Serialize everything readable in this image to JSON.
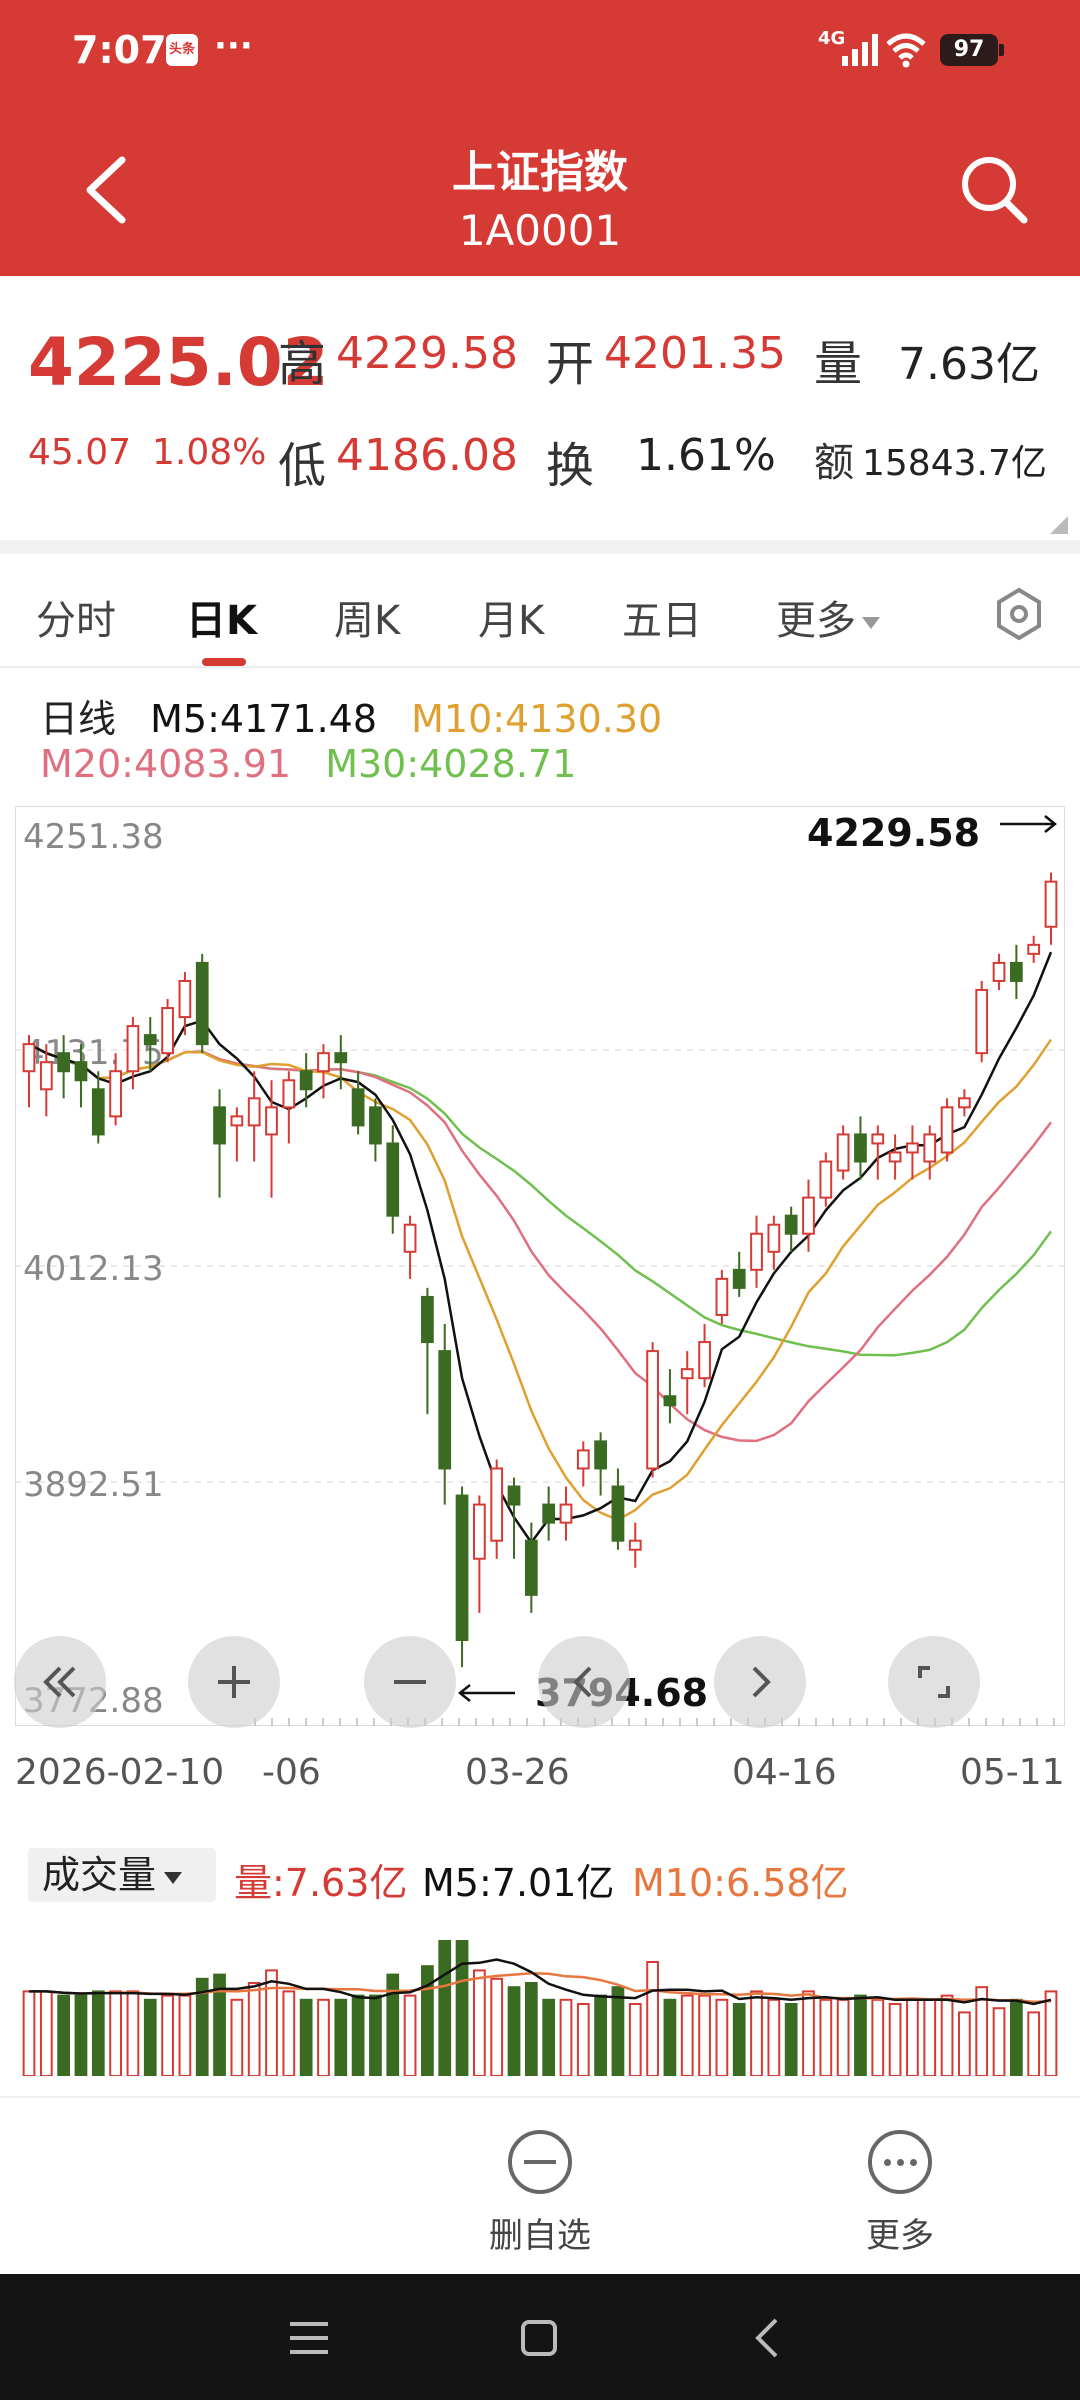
{
  "status_bar": {
    "time": "7:07",
    "notification_badge": "头条",
    "dots": "···",
    "network": "4G",
    "battery": "97"
  },
  "header": {
    "title": "上证指数",
    "code": "1A0001"
  },
  "quote": {
    "price": "4225.02",
    "change": "45.07",
    "change_pct": "1.08%",
    "high_label": "高",
    "high": "4229.58",
    "low_label": "低",
    "low": "4186.08",
    "open_label": "开",
    "open": "4201.35",
    "turnover_label": "换",
    "turnover": "1.61%",
    "volume_label": "量",
    "volume": "7.63亿",
    "amount_label": "额",
    "amount": "15843.7亿"
  },
  "tabs": [
    {
      "label": "分时",
      "active": false
    },
    {
      "label": "日K",
      "active": true
    },
    {
      "label": "周K",
      "active": false
    },
    {
      "label": "月K",
      "active": false
    },
    {
      "label": "五日",
      "active": false
    },
    {
      "label": "更多",
      "active": false
    }
  ],
  "colors": {
    "up": "#d63a35",
    "down": "#3b6b22",
    "ma5": "#111111",
    "ma10": "#e0a030",
    "ma20": "#e07080",
    "ma30": "#70c050",
    "vol_ma10": "#e8763f"
  },
  "legend": {
    "period": "日线",
    "ma5": "M5:4171.48",
    "ma10": "M10:4130.30",
    "ma20": "M20:4083.91",
    "ma30": "M30:4028.71"
  },
  "chart_data": {
    "type": "candlestick",
    "y_axis_labels": [
      "4251.38",
      "4131.75",
      "4012.13",
      "3892.51",
      "3772.88"
    ],
    "ylim": [
      3772.88,
      4251.38
    ],
    "x_axis_labels": [
      "2026-02-10",
      "-06",
      "03-26",
      "04-16",
      "05-11"
    ],
    "annotations": {
      "max": "4229.58",
      "min": "3794.68"
    },
    "candles": [
      [
        4120,
        4135,
        4100,
        4140
      ],
      [
        4110,
        4125,
        4095,
        4135
      ],
      [
        4130,
        4120,
        4105,
        4140
      ],
      [
        4125,
        4115,
        4100,
        4135
      ],
      [
        4110,
        4085,
        4080,
        4120
      ],
      [
        4095,
        4120,
        4090,
        4130
      ],
      [
        4120,
        4145,
        4110,
        4150
      ],
      [
        4140,
        4135,
        4120,
        4150
      ],
      [
        4130,
        4155,
        4125,
        4160
      ],
      [
        4150,
        4170,
        4140,
        4175
      ],
      [
        4180,
        4135,
        4130,
        4185
      ],
      [
        4100,
        4080,
        4050,
        4110
      ],
      [
        4090,
        4095,
        4070,
        4100
      ],
      [
        4090,
        4105,
        4070,
        4120
      ],
      [
        4085,
        4100,
        4050,
        4115
      ],
      [
        4100,
        4115,
        4080,
        4120
      ],
      [
        4120,
        4110,
        4100,
        4130
      ],
      [
        4120,
        4130,
        4105,
        4135
      ],
      [
        4130,
        4125,
        4110,
        4140
      ],
      [
        4110,
        4090,
        4085,
        4120
      ],
      [
        4100,
        4080,
        4070,
        4105
      ],
      [
        4080,
        4040,
        4030,
        4090
      ],
      [
        4020,
        4035,
        4005,
        4040
      ],
      [
        3995,
        3970,
        3930,
        4000
      ],
      [
        3965,
        3900,
        3880,
        3980
      ],
      [
        3885,
        3805,
        3790,
        3890
      ],
      [
        3850,
        3880,
        3820,
        3885
      ],
      [
        3860,
        3900,
        3850,
        3905
      ],
      [
        3890,
        3880,
        3850,
        3895
      ],
      [
        3860,
        3830,
        3820,
        3870
      ],
      [
        3880,
        3870,
        3860,
        3890
      ],
      [
        3870,
        3880,
        3860,
        3890
      ],
      [
        3900,
        3910,
        3890,
        3915
      ],
      [
        3915,
        3900,
        3885,
        3920
      ],
      [
        3890,
        3860,
        3855,
        3900
      ],
      [
        3855,
        3860,
        3845,
        3870
      ],
      [
        3900,
        3965,
        3895,
        3970
      ],
      [
        3940,
        3935,
        3925,
        3955
      ],
      [
        3950,
        3955,
        3930,
        3965
      ],
      [
        3950,
        3970,
        3945,
        3980
      ],
      [
        3985,
        4005,
        3980,
        4010
      ],
      [
        4010,
        4000,
        3995,
        4020
      ],
      [
        4010,
        4030,
        4000,
        4040
      ],
      [
        4020,
        4035,
        4010,
        4040
      ],
      [
        4040,
        4030,
        4020,
        4045
      ],
      [
        4030,
        4050,
        4020,
        4060
      ],
      [
        4050,
        4070,
        4045,
        4075
      ],
      [
        4065,
        4085,
        4060,
        4090
      ],
      [
        4085,
        4070,
        4060,
        4095
      ],
      [
        4080,
        4085,
        4060,
        4090
      ],
      [
        4070,
        4075,
        4060,
        4085
      ],
      [
        4075,
        4080,
        4060,
        4090
      ],
      [
        4070,
        4085,
        4060,
        4090
      ],
      [
        4075,
        4100,
        4070,
        4105
      ],
      [
        4100,
        4105,
        4095,
        4110
      ],
      [
        4130,
        4165,
        4125,
        4170
      ],
      [
        4170,
        4180,
        4165,
        4185
      ],
      [
        4180,
        4170,
        4160,
        4190
      ],
      [
        4185,
        4190,
        4180,
        4195
      ],
      [
        4200,
        4225,
        4190,
        4230
      ]
    ]
  },
  "volume": {
    "selector": "成交量",
    "vol": "量:7.63亿",
    "m5": "M5:7.01亿",
    "m10": "M10:6.58亿"
  },
  "actions": [
    {
      "label": "删自选",
      "icon": "minus-circle-icon"
    },
    {
      "label": "更多",
      "icon": "more-circle-icon"
    }
  ]
}
